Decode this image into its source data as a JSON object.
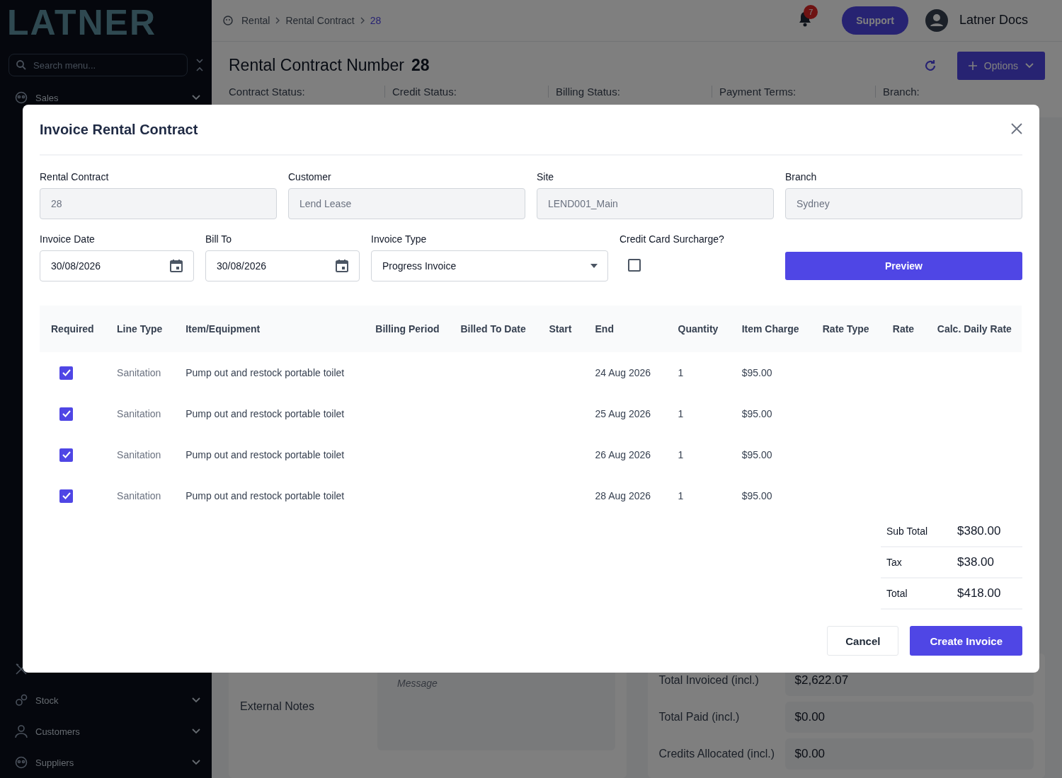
{
  "sidebar": {
    "logo": "LATNER",
    "search": {
      "placeholder": "Search menu..."
    },
    "top_items": [
      {
        "label": "Sales"
      }
    ],
    "bottom_items": [
      {
        "label": "Stock"
      },
      {
        "label": "Customers"
      },
      {
        "label": "Suppliers"
      }
    ]
  },
  "header": {
    "breadcrumb": [
      {
        "label": "Rental",
        "selected": false
      },
      {
        "label": "Rental Contract",
        "selected": false
      },
      {
        "label": "28",
        "selected": true
      }
    ],
    "notification_count": "7",
    "support": "Support",
    "user": "Latner Docs"
  },
  "page": {
    "title": "Rental Contract Number",
    "number": "28",
    "options": "Options",
    "status_labels": [
      "Contract Status:",
      "Credit Status:",
      "Billing Status:",
      "Payment Terms:",
      "Branch:"
    ],
    "notes": {
      "message_placeholder": "Message",
      "external_notes": "External Notes"
    },
    "totals": [
      {
        "label": "Total Invoiced (incl.)",
        "value": "$2,622.07"
      },
      {
        "label": "Total Paid (incl.)",
        "value": "$0.00"
      },
      {
        "label": "Credits Allocated (incl.)",
        "value": "$0.00"
      }
    ]
  },
  "dialog": {
    "title": "Invoice Rental Contract",
    "fields": [
      {
        "kind": "text",
        "label": "Rental Contract",
        "value": "28",
        "disabled": true
      },
      {
        "kind": "text",
        "label": "Customer",
        "value": "Lend Lease",
        "disabled": true
      },
      {
        "kind": "text",
        "label": "Site",
        "value": "LEND001_Main",
        "disabled": true
      },
      {
        "kind": "text",
        "label": "Branch",
        "value": "Sydney",
        "disabled": true
      },
      {
        "kind": "date",
        "label": "Invoice Date",
        "value": "30/08/2026",
        "disabled": false
      },
      {
        "kind": "date",
        "label": "Bill To",
        "value": "30/08/2026",
        "disabled": false
      },
      {
        "kind": "select",
        "label": "Invoice Type",
        "value": "Progress Invoice",
        "disabled": false
      },
      {
        "kind": "checkbox",
        "label": "Credit Card Surcharge?",
        "checked": false
      }
    ],
    "preview": "Preview",
    "columns": [
      "Required",
      "Line Type",
      "Item/Equipment",
      "Billing Period",
      "Billed To Date",
      "Start",
      "End",
      "Quantity",
      "Item Charge",
      "Rate Type",
      "Rate",
      "Calc. Daily Rate"
    ],
    "rows": [
      {
        "required": true,
        "line_type": "Sanitation",
        "item": "Pump out and restock portable toilet",
        "end": "24 Aug 2026",
        "quantity": "1",
        "item_charge": "$95.00"
      },
      {
        "required": true,
        "line_type": "Sanitation",
        "item": "Pump out and restock portable toilet",
        "end": "25 Aug 2026",
        "quantity": "1",
        "item_charge": "$95.00"
      },
      {
        "required": true,
        "line_type": "Sanitation",
        "item": "Pump out and restock portable toilet",
        "end": "26 Aug 2026",
        "quantity": "1",
        "item_charge": "$95.00"
      },
      {
        "required": true,
        "line_type": "Sanitation",
        "item": "Pump out and restock portable toilet",
        "end": "28 Aug 2026",
        "quantity": "1",
        "item_charge": "$95.00"
      }
    ],
    "totals": [
      {
        "label": "Sub Total",
        "value": "$380.00"
      },
      {
        "label": "Tax",
        "value": "$38.00"
      },
      {
        "label": "Total",
        "value": "$418.00"
      }
    ],
    "buttons": [
      {
        "kind": "secondary",
        "label": "Cancel"
      },
      {
        "kind": "primary",
        "label": "Create Invoice"
      }
    ]
  }
}
